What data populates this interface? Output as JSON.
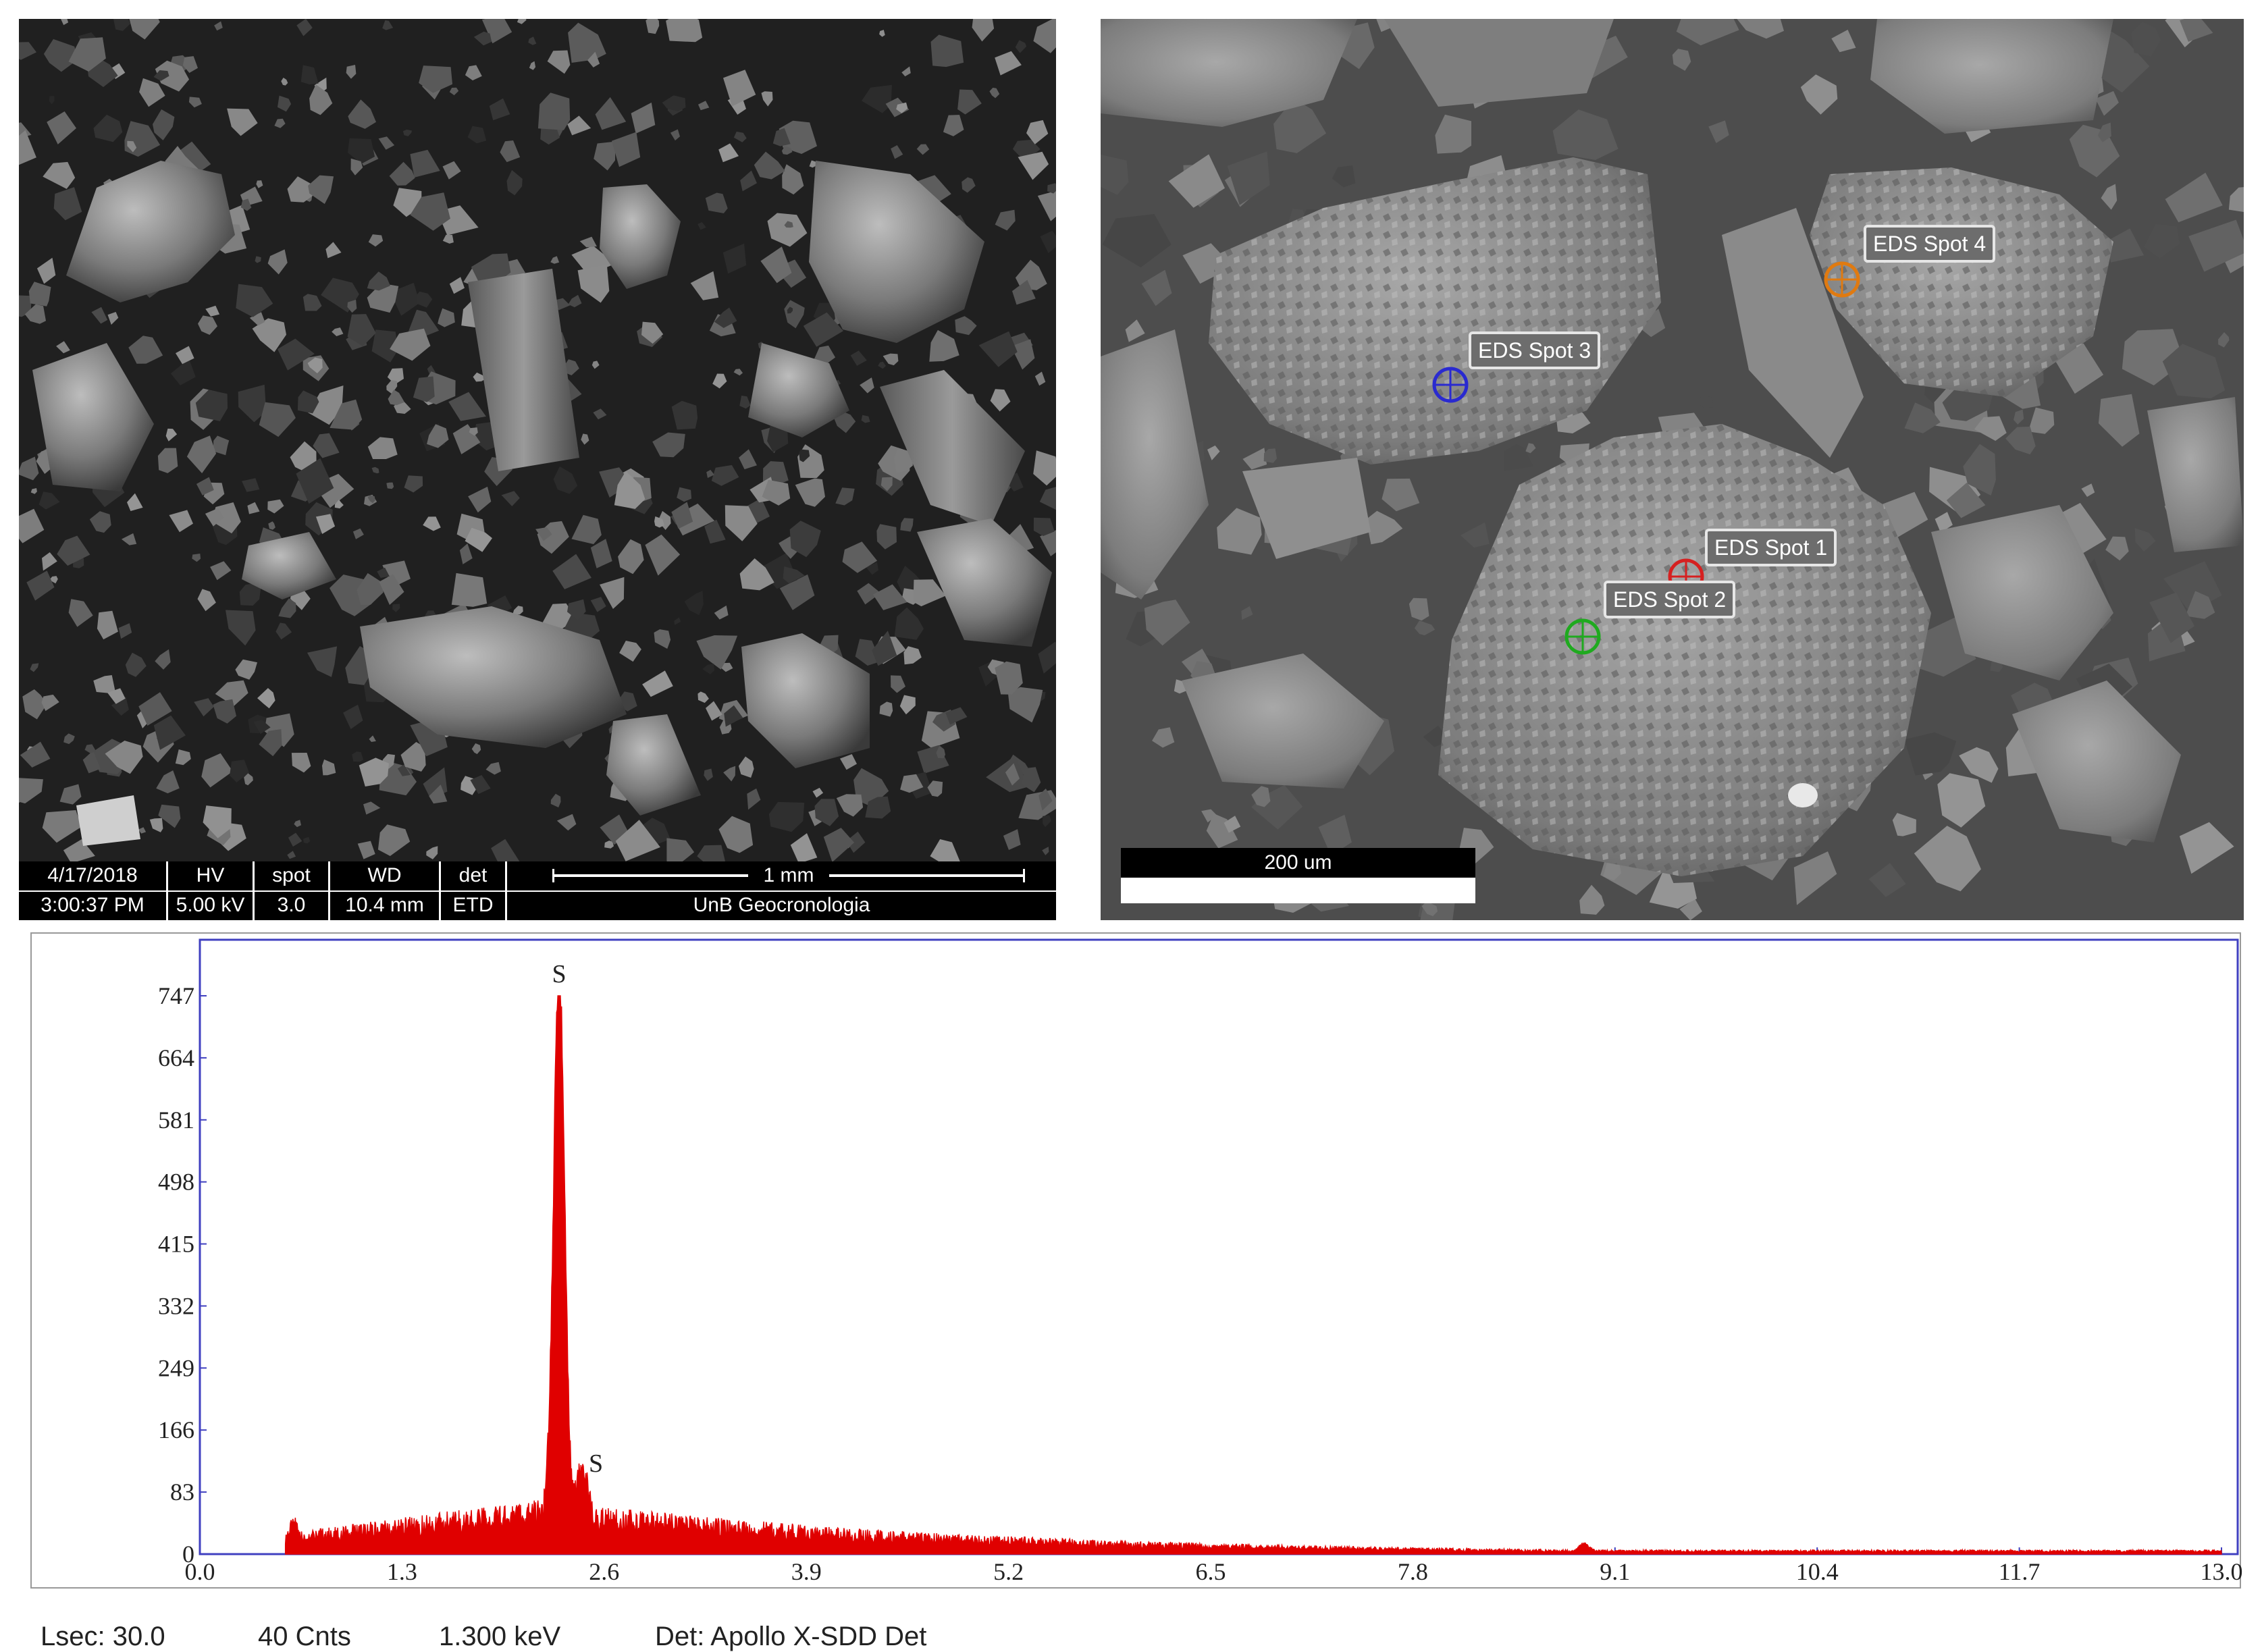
{
  "sem_left": {
    "info_bar": {
      "date": "4/17/2018",
      "time": "3:00:37 PM",
      "hv_label": "HV",
      "hv_value": "5.00 kV",
      "spot_label": "spot",
      "spot_value": "3.0",
      "wd_label": "WD",
      "wd_value": "10.4 mm",
      "det_label": "det",
      "det_value": "ETD",
      "scale_label": "1 mm",
      "lab": "UnB Geocronologia"
    }
  },
  "sem_right": {
    "scale_label": "200 um",
    "spots": [
      {
        "label": "EDS Spot 1",
        "color": "#d62020"
      },
      {
        "label": "EDS Spot 2",
        "color": "#1faa1f"
      },
      {
        "label": "EDS Spot 3",
        "color": "#2a2ad0"
      },
      {
        "label": "EDS Spot 4",
        "color": "#e07a10"
      }
    ]
  },
  "spectrum": {
    "footer": {
      "lsec": "Lsec: 30.0",
      "cnts": "40 Cnts",
      "kev": "1.300 keV",
      "det": "Det: Apollo X-SDD Det"
    },
    "peak_labels": [
      "S",
      "S"
    ],
    "peak_positions_kev": [
      2.31,
      2.46
    ],
    "y_ticks": [
      "0",
      "83",
      "166",
      "249",
      "332",
      "415",
      "498",
      "581",
      "664",
      "747"
    ],
    "x_ticks": [
      "0.0",
      "1.3",
      "2.6",
      "3.9",
      "5.2",
      "6.5",
      "7.8",
      "9.1",
      "10.4",
      "11.7",
      "13.0"
    ],
    "xlim": [
      0,
      13.0
    ],
    "ylim": [
      0,
      747
    ],
    "colors": {
      "trace": "#e00000",
      "frame": "#4040c0"
    }
  }
}
